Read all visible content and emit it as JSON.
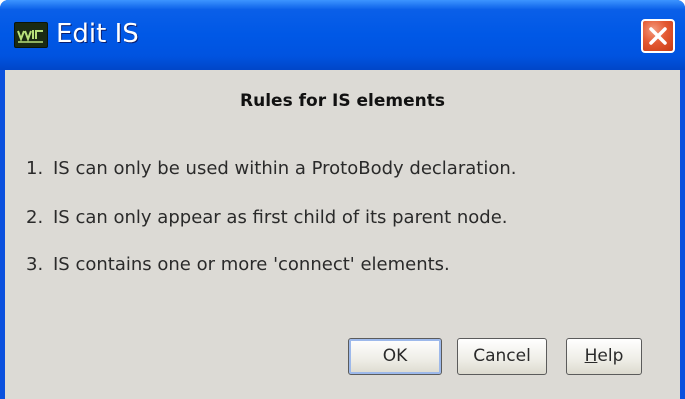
{
  "window": {
    "title": "Edit IS",
    "icon": "dataflow-app-icon",
    "close_icon": "close-icon",
    "colors": {
      "titlebar": "#0058e6",
      "close": "#e45a33",
      "panel": "#dcdad5"
    }
  },
  "dialog": {
    "heading": "Rules for IS elements",
    "rules": [
      {
        "number": "1.",
        "text": "IS can only be used within a ProtoBody declaration."
      },
      {
        "number": "2.",
        "text": "IS can only appear as first child of its parent node."
      },
      {
        "number": "3.",
        "text": "IS contains one or more 'connect' elements."
      }
    ]
  },
  "buttons": {
    "ok": "OK",
    "cancel": "Cancel",
    "help_mnemonic": "H",
    "help_rest": "elp"
  }
}
